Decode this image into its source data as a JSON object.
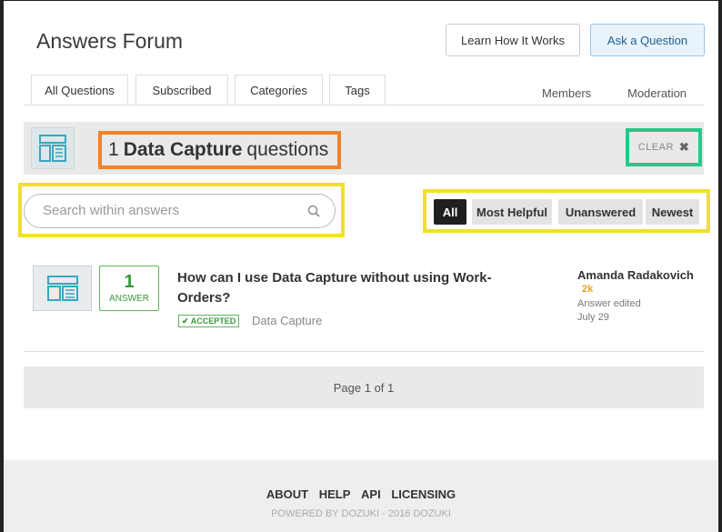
{
  "header": {
    "title": "Answers Forum",
    "learn_label": "Learn How It Works",
    "ask_label": "Ask a Question"
  },
  "tabs": {
    "left": [
      "All Questions",
      "Subscribed",
      "Categories",
      "Tags"
    ],
    "right": [
      "Members",
      "Moderation"
    ]
  },
  "banner": {
    "count": "1",
    "category": "Data Capture",
    "suffix": "questions",
    "clear_label": "CLEAR",
    "clear_icon": "close-icon"
  },
  "search": {
    "placeholder": "Search within answers",
    "icon": "search-icon"
  },
  "filters": [
    "All",
    "Most Helpful",
    "Unanswered",
    "Newest"
  ],
  "selected_filter": "All",
  "question": {
    "answer_count": "1",
    "answer_label": "ANSWER",
    "title": "How can I use Data Capture without using Work-Orders?",
    "badge": "✔ ACCEPTED",
    "category": "Data Capture",
    "author": "Amanda Radakovich",
    "reputation": "2k",
    "status": "Answer edited",
    "date": "July 29"
  },
  "pagination": {
    "label": "Page 1 of 1"
  },
  "footer": {
    "links": [
      "ABOUT",
      "HELP",
      "API",
      "LICENSING"
    ],
    "credit": "POWERED BY DOZUKI - 2016 DOZUKI"
  },
  "colors": {
    "accent": "#1d5f93",
    "accepted": "#5cb85c",
    "reputation": "#f0a020",
    "highlight_orange": "#f0832a",
    "highlight_yellow": "#f0e02a",
    "highlight_green": "#22c98a"
  }
}
